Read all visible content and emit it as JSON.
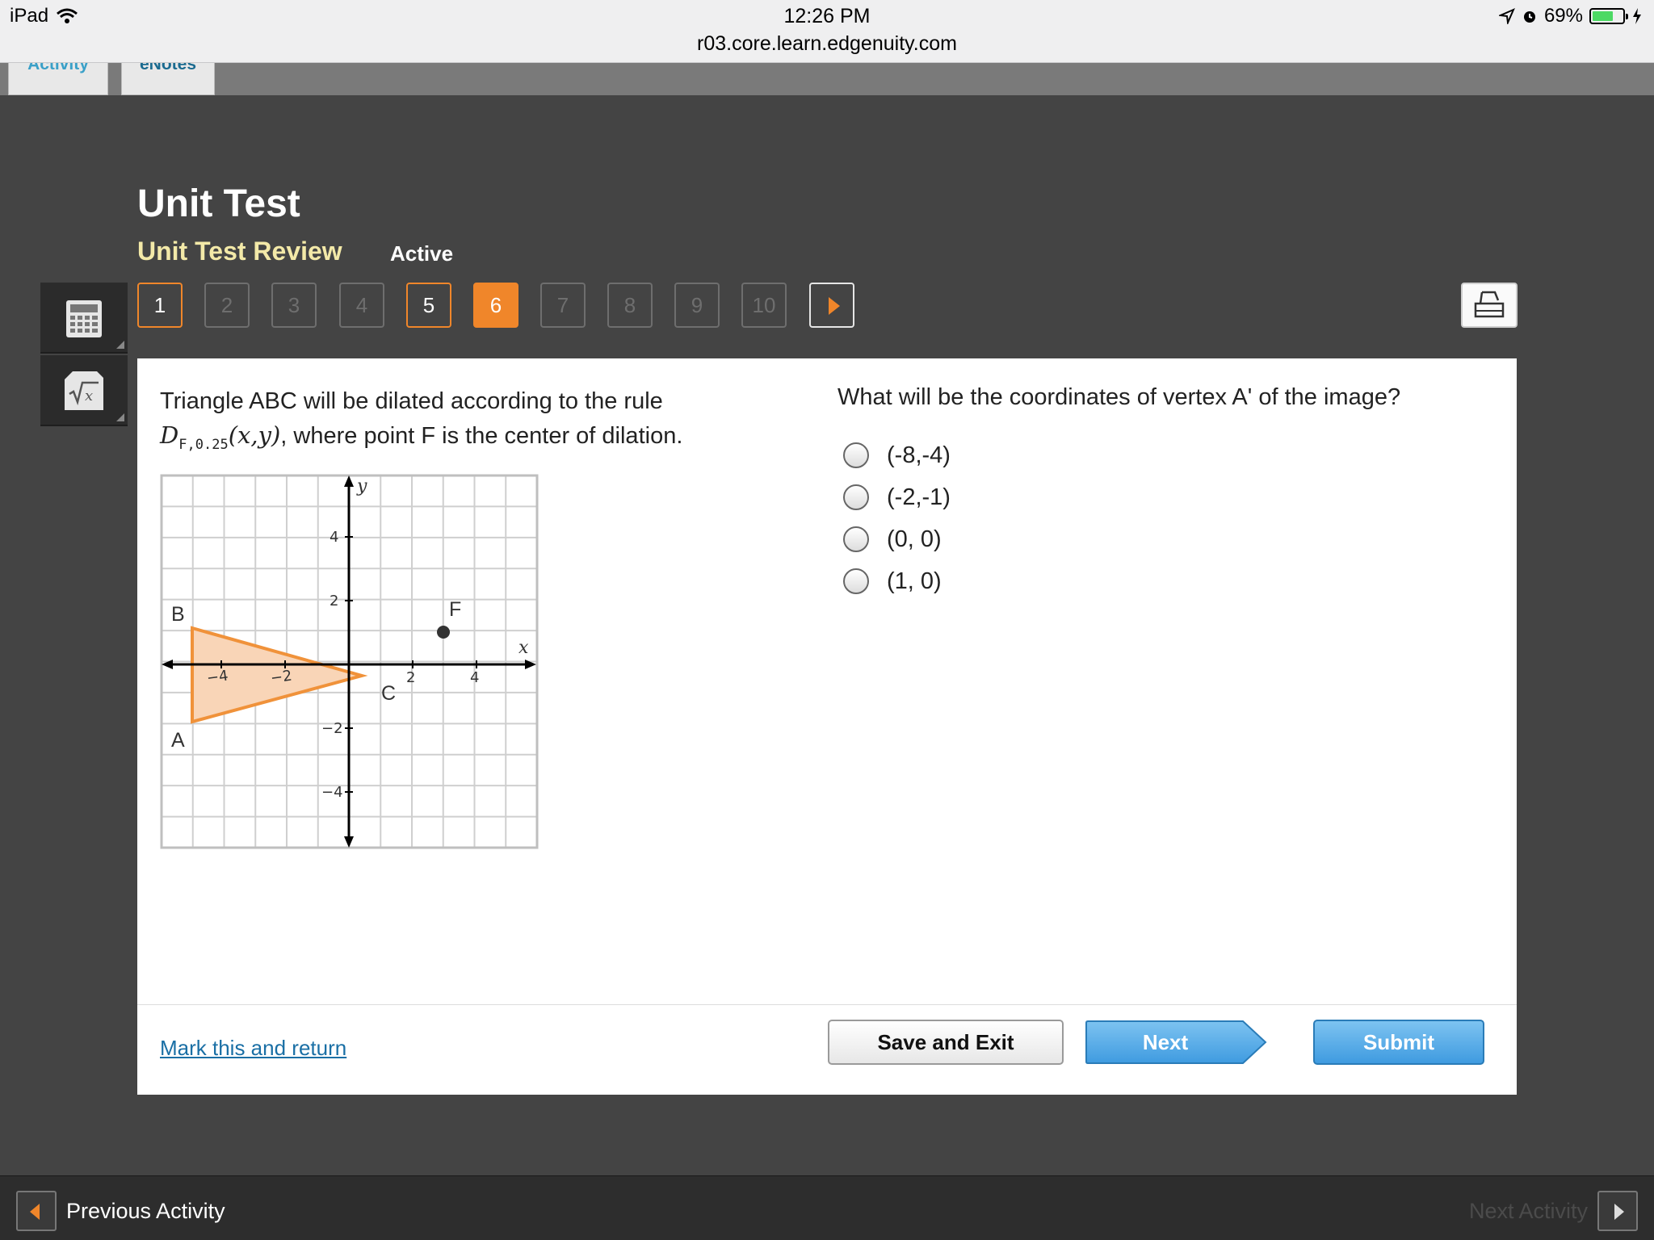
{
  "status_bar": {
    "device": "iPad",
    "time": "12:26 PM",
    "url": "r03.core.learn.edgenuity.com",
    "battery": "69%"
  },
  "tabs": [
    {
      "label": "Activity"
    },
    {
      "label": "eNotes"
    }
  ],
  "header": {
    "title": "Unit Test",
    "subtitle": "Unit Test Review",
    "status": "Active"
  },
  "question_nav": [
    {
      "label": "1",
      "state": "answered"
    },
    {
      "label": "2",
      "state": "unanswered"
    },
    {
      "label": "3",
      "state": "unanswered"
    },
    {
      "label": "4",
      "state": "unanswered"
    },
    {
      "label": "5",
      "state": "answered"
    },
    {
      "label": "6",
      "state": "current"
    },
    {
      "label": "7",
      "state": "unanswered"
    },
    {
      "label": "8",
      "state": "unanswered"
    },
    {
      "label": "9",
      "state": "unanswered"
    },
    {
      "label": "10",
      "state": "unanswered"
    }
  ],
  "prompt": {
    "line1": "Triangle ABC will be dilated according to the rule",
    "rule_letter": "D",
    "rule_subscript": "F,0.25",
    "rule_args": "(x,y)",
    "line2_rest": ", where point F is the center of dilation."
  },
  "graph": {
    "x_axis_label": "x",
    "y_axis_label": "y",
    "x_tick_labels": [
      "−4",
      "−2",
      "2",
      "4"
    ],
    "y_tick_labels": [
      "4",
      "2",
      "−2",
      "−4"
    ],
    "points": {
      "A": "A",
      "B": "B",
      "C": "C",
      "F": "F"
    },
    "triangle_fill": "#f9d5b7",
    "triangle_stroke": "#f0923a"
  },
  "question": "What will be the coordinates of vertex A' of the image?",
  "choices": [
    "(-8,-4)",
    "(-2,-1)",
    "(0, 0)",
    "(1, 0)"
  ],
  "footer": {
    "mark_link": "Mark this and return",
    "save_exit": "Save and Exit",
    "next": "Next",
    "submit": "Submit"
  },
  "bottom_bar": {
    "previous": "Previous Activity",
    "next": "Next Activity"
  },
  "colors": {
    "accent_orange": "#f0862a",
    "button_blue": "#4aa3e6",
    "subtitle_yellow": "#f3e9a8"
  }
}
